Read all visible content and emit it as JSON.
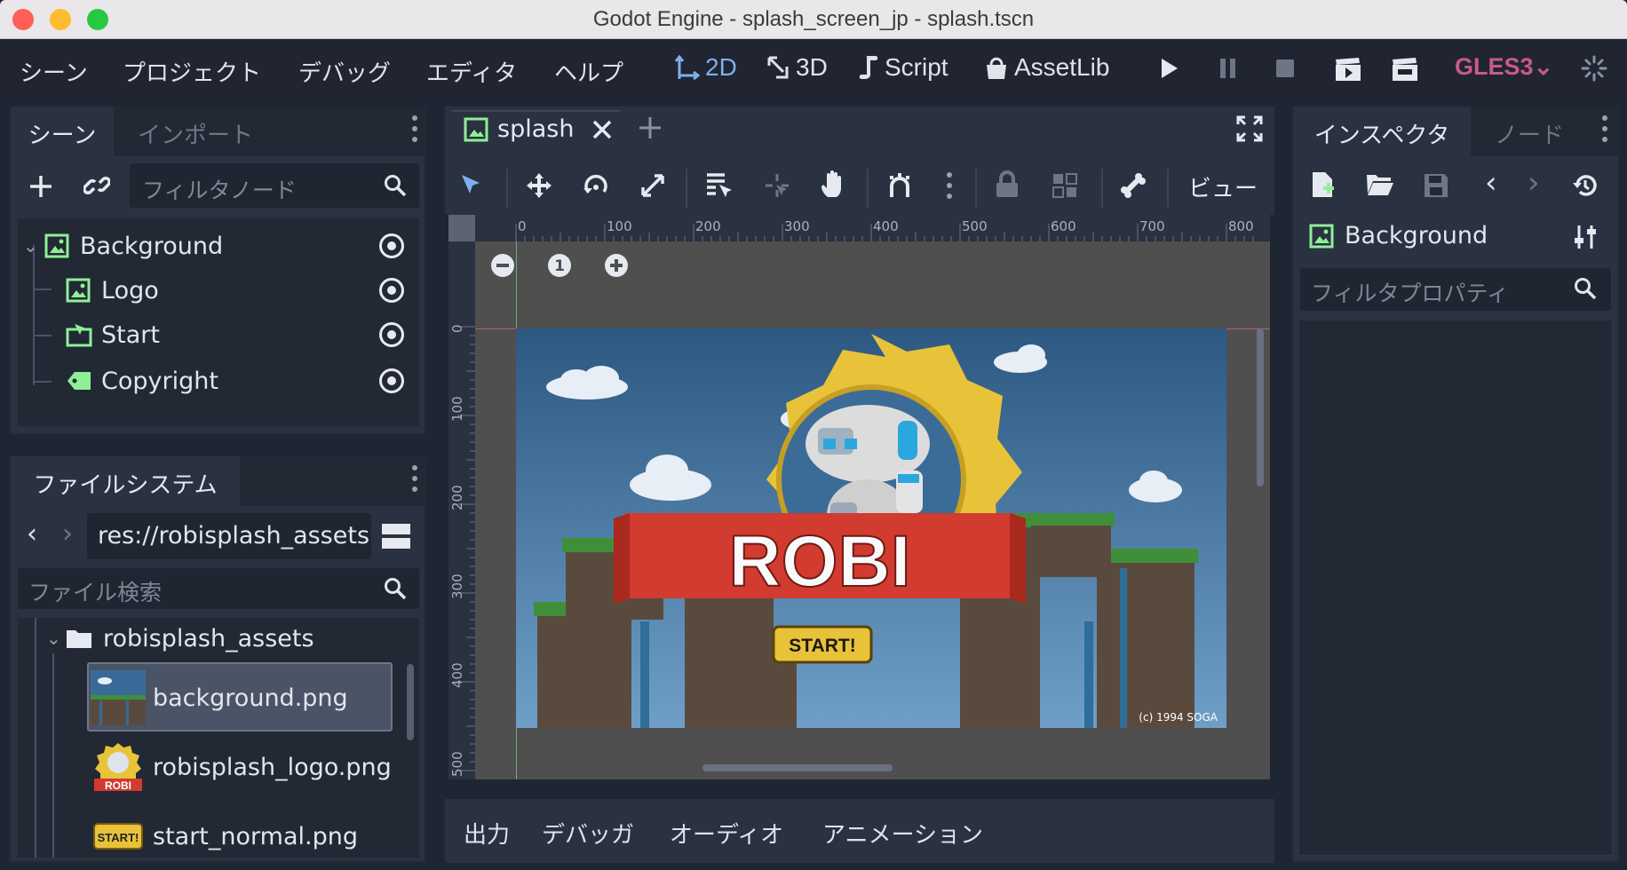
{
  "window": {
    "title": "Godot Engine - splash_screen_jp - splash.tscn"
  },
  "menu": [
    "シーン",
    "プロジェクト",
    "デバッグ",
    "エディタ",
    "ヘルプ"
  ],
  "modes": {
    "m2d": "2D",
    "m3d": "3D",
    "script": "Script",
    "assetlib": "AssetLib"
  },
  "renderer": "GLES3",
  "scene_panel": {
    "tabs": [
      "シーン",
      "インポート"
    ],
    "filter_placeholder": "フィルタノード",
    "nodes": [
      "Background",
      "Logo",
      "Start",
      "Copyright"
    ]
  },
  "filesystem": {
    "tab": "ファイルシステム",
    "path": "res://robisplash_assets",
    "search_placeholder": "ファイル検索",
    "folder": "robisplash_assets",
    "files": [
      "background.png",
      "robisplash_logo.png",
      "start_normal.png"
    ]
  },
  "viewport": {
    "tab": "splash",
    "view_label": "ビュー",
    "zoom_reset": "1",
    "ruler_h": [
      "0",
      "100",
      "200",
      "300",
      "400",
      "500",
      "600",
      "700",
      "800"
    ],
    "ruler_v": [
      "0",
      "100",
      "200",
      "300",
      "400",
      "500"
    ],
    "splash": {
      "logo_text": "ROBI",
      "start": "START!",
      "copyright": "(c) 1994 SOGA"
    }
  },
  "bottom_tabs": [
    "出力",
    "デバッガ",
    "オーディオ",
    "アニメーション"
  ],
  "inspector": {
    "tabs": [
      "インスペクタ",
      "ノード"
    ],
    "object": "Background",
    "filter_placeholder": "フィルタプロパティ"
  },
  "colors": {
    "accent": "#7faeef",
    "node_green": "#8eef97",
    "gles": "#c9598a",
    "sky": "#3a6b98",
    "banner": "#d23b2f",
    "gear": "#e8c33a"
  }
}
